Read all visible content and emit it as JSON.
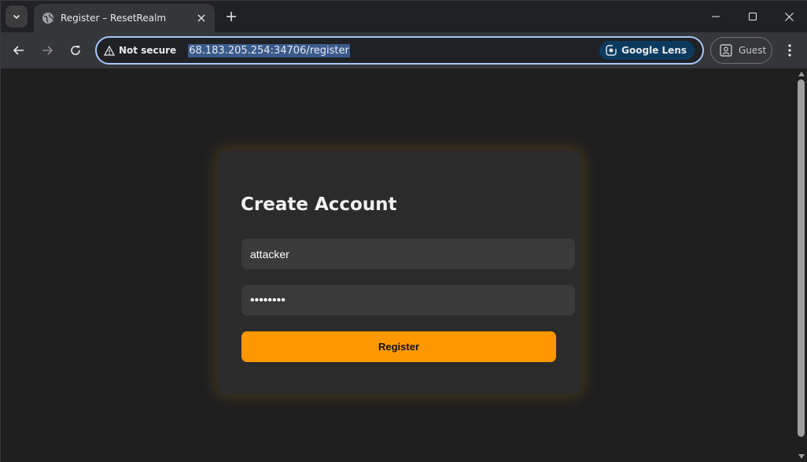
{
  "browser": {
    "tab": {
      "title": "Register – ResetRealm",
      "favicon": "globe-icon"
    },
    "toolbar": {
      "security_label": "Not secure",
      "url": "68.183.205.254:34706/register",
      "lens_label": "Google Lens",
      "profile_label": "Guest"
    },
    "colors": {
      "omnibox_focus": "#a8c7fa",
      "tab_active": "#35363a",
      "frame": "#202124"
    }
  },
  "page": {
    "title": "Create Account",
    "username_value": "attacker",
    "password_value": "••••••••",
    "submit_label": "Register",
    "colors": {
      "background": "#1f1f1f",
      "card": "#2b2b2b",
      "input": "#3a3a3a",
      "accent": "#ff9800"
    }
  }
}
